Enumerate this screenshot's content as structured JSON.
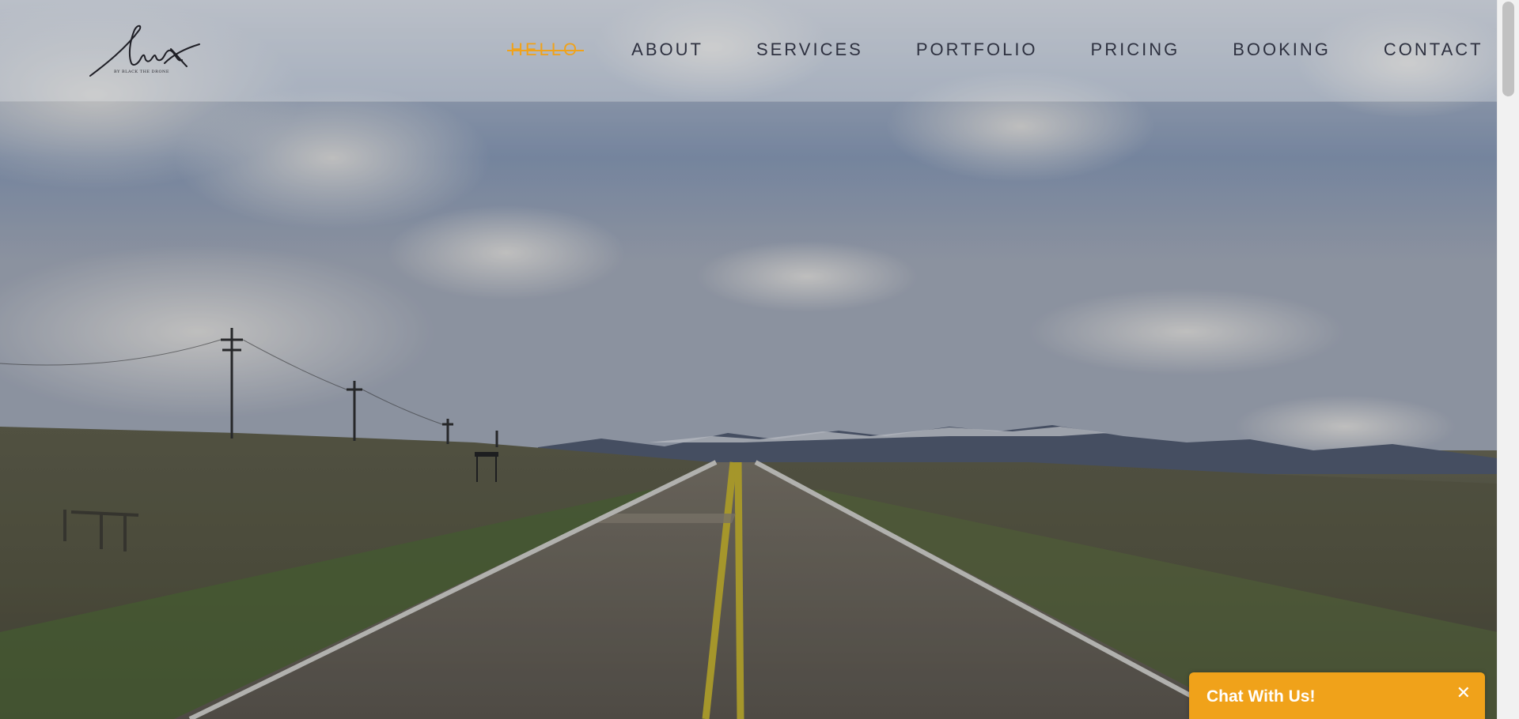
{
  "logo": {
    "text": "lux",
    "tagline": "BY BLACK THE DRONE",
    "icon": "lux-signature-logo"
  },
  "nav": {
    "items": [
      {
        "label": "HELLO",
        "active": true
      },
      {
        "label": "ABOUT",
        "active": false
      },
      {
        "label": "SERVICES",
        "active": false
      },
      {
        "label": "PORTFOLIO",
        "active": false
      },
      {
        "label": "PRICING",
        "active": false
      },
      {
        "label": "BOOKING",
        "active": false
      },
      {
        "label": "CONTACT",
        "active": false
      }
    ]
  },
  "hero": {
    "image": "open-road-landscape"
  },
  "chat": {
    "title": "Chat With Us!",
    "close_glyph": "✕",
    "close_icon": "close-icon"
  },
  "colors": {
    "accent": "#f0a21a",
    "nav_text": "#2e3140",
    "header_overlay": "rgba(230,232,236,0.35)"
  }
}
